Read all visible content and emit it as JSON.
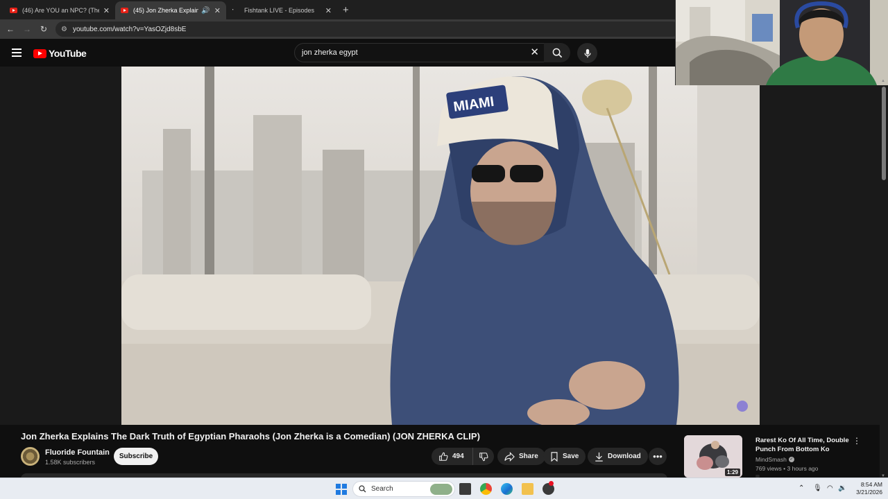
{
  "browser": {
    "tabs": [
      {
        "label": "(46) Are YOU an NPC? (The Mi",
        "active": false
      },
      {
        "label": "(45) Jon Zherka Explains Th",
        "active": true
      },
      {
        "label": "Fishtank LIVE - Episodes",
        "active": false
      }
    ],
    "url": "youtube.com/watch?v=YasOZjd8sbE"
  },
  "youtube": {
    "logo_text": "YouTube",
    "search_value": "jon zherka egypt"
  },
  "video": {
    "title": "Jon Zherka Explains The Dark Truth of Egyptian Pharaohs (Jon Zherka is a Comedian) (JON ZHERKA CLIP)",
    "cap_text": "MIAMI",
    "channel_name": "Fluoride Fountain",
    "subscribers": "1.58K subscribers",
    "subscribe_label": "Subscribe",
    "likes": "494",
    "share_label": "Share",
    "save_label": "Save",
    "download_label": "Download"
  },
  "recommendation": {
    "title": "Rarest Ko Of All Time, Double Punch From Bottom Ko",
    "channel": "MindSmash",
    "meta": "769 views • 3 hours ago",
    "duration": "1:29"
  },
  "taskbar": {
    "search_placeholder": "Search",
    "time": "8:54 AM",
    "date": "3/21/2026"
  },
  "colors": {
    "youtube_red": "#ff0000",
    "background": "#0f0f0f",
    "pill": "#272727"
  }
}
